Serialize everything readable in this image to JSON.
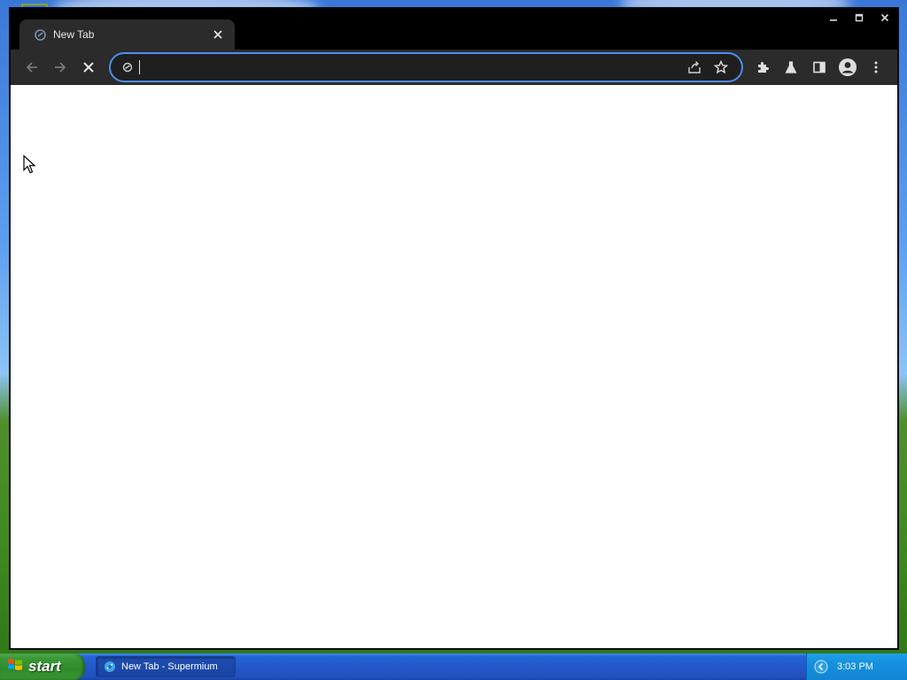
{
  "browser": {
    "app_name": "Supermium",
    "tab": {
      "title": "New Tab",
      "close_icon": "close-icon",
      "favicon": "supermium-favicon"
    },
    "window_controls": {
      "minimize": "minimize-icon",
      "maximize": "maximize-icon",
      "close": "close-icon"
    },
    "toolbar": {
      "back": "arrow-left-icon",
      "forward": "arrow-right-icon",
      "stop": "stop-icon",
      "omnibox": {
        "value": "",
        "placeholder": ""
      },
      "share": "share-icon",
      "bookmark": "star-icon",
      "extensions": "puzzle-icon",
      "labs": "flask-icon",
      "side_panel": "side-panel-icon",
      "profile": "profile-avatar-icon",
      "menu": "kebab-menu-icon"
    },
    "content": {
      "background": "#ffffff"
    },
    "colors": {
      "chrome": "#2b2b2b",
      "titlebar": "#000000",
      "omnibox_focus": "#4d8ef0"
    }
  },
  "taskbar": {
    "start_label": "start",
    "items": [
      {
        "label": "New Tab - Supermium"
      }
    ],
    "clock": "3:03 PM",
    "colors": {
      "bar": "#2458c8",
      "start": "#3c9a38",
      "tray": "#1590de"
    }
  }
}
